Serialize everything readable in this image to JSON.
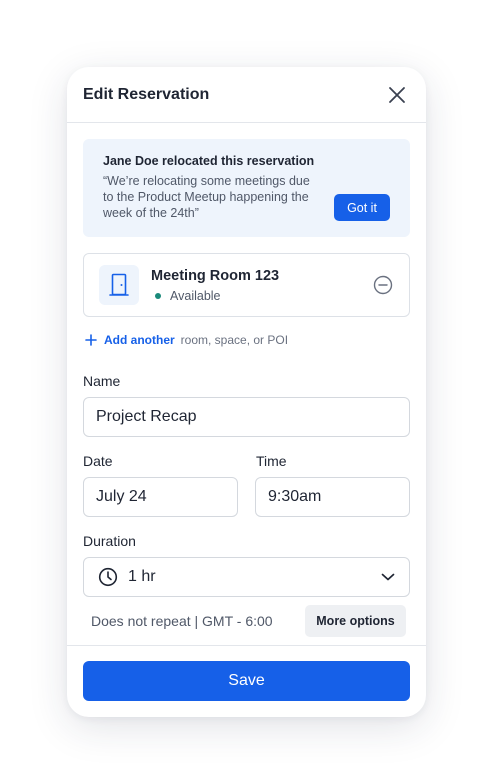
{
  "dialog": {
    "title": "Edit Reservation"
  },
  "notice": {
    "title": "Jane Doe relocated this reservation",
    "message": "“We’re relocating some meetings due to the Product Meetup happening the week of the 24th”",
    "button_label": "Got it"
  },
  "room": {
    "name": "Meeting Room 123",
    "status": "Available",
    "status_color": "#1a8a7a",
    "icon": "door-icon"
  },
  "add_another": {
    "link_label": "Add another",
    "hint": "room, space, or POI"
  },
  "form": {
    "name_label": "Name",
    "name_value": "Project Recap",
    "date_label": "Date",
    "date_value": "July 24",
    "time_label": "Time",
    "time_value": "9:30am",
    "duration_label": "Duration",
    "duration_value": "1 hr",
    "repeat_text": "Does not repeat | GMT - 6:00",
    "more_options_label": "More options"
  },
  "footer": {
    "save_label": "Save"
  },
  "colors": {
    "accent": "#1660e8",
    "notice_bg": "#eef4fc"
  }
}
